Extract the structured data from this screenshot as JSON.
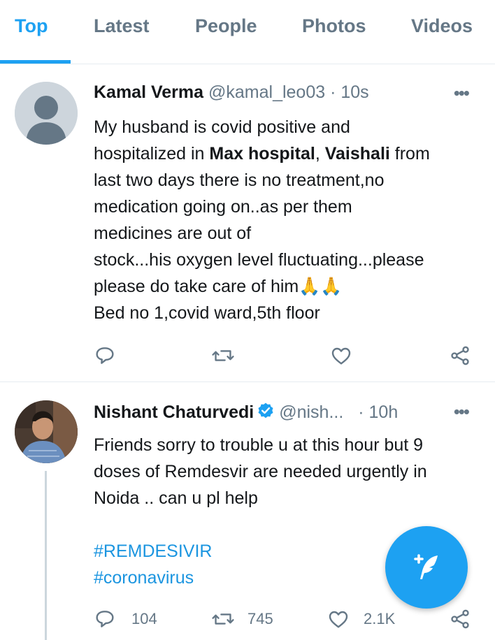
{
  "tabs": [
    "Top",
    "Latest",
    "People",
    "Photos",
    "Videos"
  ],
  "tweets": [
    {
      "name": "Kamal Verma",
      "handle": "@kamal_leo03",
      "time": "· 10s",
      "lines": [
        [
          "My husband is covid positive and"
        ],
        [
          "hospitalized in ",
          "Max hospital",
          ", ",
          "Vaishali",
          " from"
        ],
        [
          "last two days there is no treatment,no"
        ],
        [
          "medication going on..as per them"
        ],
        [
          "medicines are out of"
        ],
        [
          "stock...his oxygen level fluctuating...please"
        ],
        [
          "please do take care of him🙏🙏"
        ],
        [
          "Bed no 1,covid ward,5th floor"
        ]
      ],
      "replies": "",
      "retweets": "",
      "likes": ""
    },
    {
      "name": "Nishant Chaturvedi",
      "handle": "@nish...",
      "time": "· 10h",
      "lines": [
        [
          "Friends sorry to trouble u at this hour but 9"
        ],
        [
          "doses of Remdesvir are needed urgently in"
        ],
        [
          "Noida .. can u pl help"
        ]
      ],
      "hashtags": [
        "#REMDESIVIR",
        "#coronavirus"
      ],
      "replies": "104",
      "retweets": "745",
      "likes": "2.1K"
    }
  ],
  "more_label": "•••",
  "colors": {
    "accent": "#1da1f2",
    "secondary_text": "#657786",
    "divider": "#e6ecf0"
  },
  "icons": [
    "reply-icon",
    "retweet-icon",
    "like-icon",
    "share-icon",
    "verified-icon",
    "compose-tweet-icon"
  ]
}
